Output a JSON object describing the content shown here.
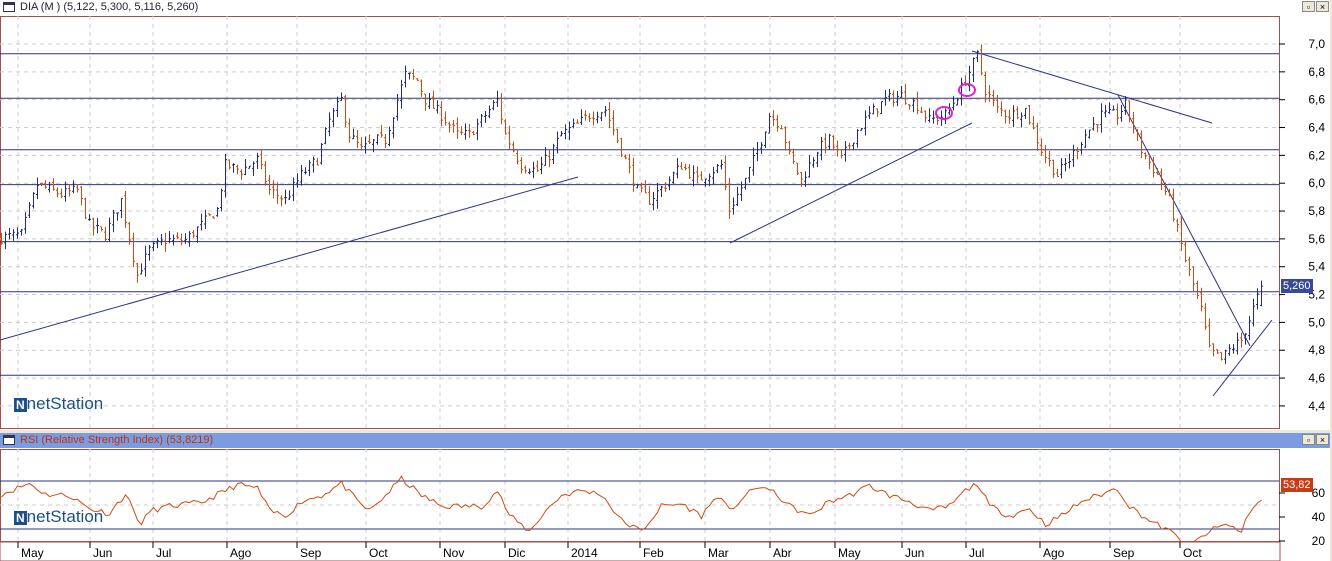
{
  "main": {
    "title": "DIA (M ) (5,122, 5,300, 5,116, 5,260)",
    "last_label": "5,260",
    "logo": "netStation",
    "y_ticks": [
      "7,0",
      "6,8",
      "6,6",
      "6,4",
      "6,2",
      "6,0",
      "5,8",
      "5,6",
      "5,4",
      "5,2",
      "5,0",
      "4,8",
      "4,6",
      "4,4"
    ]
  },
  "rsi": {
    "title": "RSI (Relative Strength Index) (53,8219)",
    "last_label": "53,82",
    "logo": "netStation",
    "y_ticks": [
      "60",
      "40",
      "20"
    ]
  },
  "window_buttons": {
    "restore": "▫",
    "close": "×"
  },
  "months": [
    "May",
    "Jun",
    "Jul",
    "Ago",
    "Sep",
    "Oct",
    "Nov",
    "Dic",
    "2014",
    "Feb",
    "Mar",
    "Abr",
    "May",
    "Jun",
    "Jul",
    "Ago",
    "Sep",
    "Oct"
  ],
  "colors": {
    "up": "#1f2a8a",
    "down": "#d04a10",
    "line": "#2b3580",
    "rsi": "#d04a10",
    "header_rsi": "#7b9de0",
    "frame": "#a05050"
  },
  "chart_data": {
    "type": "ohlc",
    "price_range": [
      4.4,
      7.0
    ],
    "support_resistance_levels": [
      6.93,
      6.61,
      6.24,
      5.99,
      5.58,
      5.22,
      4.62
    ],
    "last": {
      "open": 5.122,
      "high": 5.3,
      "low": 5.116,
      "close": 5.26
    },
    "close_keypoints": [
      [
        0,
        5.61
      ],
      [
        5,
        5.63
      ],
      [
        9,
        5.99
      ],
      [
        15,
        5.92
      ],
      [
        19,
        5.95
      ],
      [
        22,
        5.7
      ],
      [
        26,
        5.63
      ],
      [
        30,
        5.88
      ],
      [
        34,
        5.34
      ],
      [
        37,
        5.52
      ],
      [
        41,
        5.59
      ],
      [
        46,
        5.59
      ],
      [
        50,
        5.7
      ],
      [
        54,
        5.81
      ],
      [
        56,
        6.13
      ],
      [
        60,
        6.09
      ],
      [
        64,
        6.17
      ],
      [
        67,
        5.95
      ],
      [
        71,
        5.88
      ],
      [
        75,
        6.06
      ],
      [
        79,
        6.17
      ],
      [
        82,
        6.45
      ],
      [
        85,
        6.6
      ],
      [
        87,
        6.35
      ],
      [
        90,
        6.24
      ],
      [
        94,
        6.31
      ],
      [
        96,
        6.31
      ],
      [
        99,
        6.6
      ],
      [
        101,
        6.78
      ],
      [
        104,
        6.74
      ],
      [
        106,
        6.6
      ],
      [
        110,
        6.49
      ],
      [
        114,
        6.35
      ],
      [
        117,
        6.35
      ],
      [
        121,
        6.49
      ],
      [
        124,
        6.6
      ],
      [
        126,
        6.35
      ],
      [
        130,
        6.13
      ],
      [
        134,
        6.09
      ],
      [
        137,
        6.2
      ],
      [
        140,
        6.35
      ],
      [
        144,
        6.42
      ],
      [
        147,
        6.49
      ],
      [
        151,
        6.53
      ],
      [
        155,
        6.24
      ],
      [
        159,
        5.95
      ],
      [
        162,
        5.88
      ],
      [
        166,
        5.99
      ],
      [
        170,
        6.13
      ],
      [
        174,
        6.02
      ],
      [
        176,
        6.06
      ],
      [
        180,
        6.13
      ],
      [
        182,
        5.81
      ],
      [
        186,
        6.02
      ],
      [
        190,
        6.31
      ],
      [
        192,
        6.49
      ],
      [
        195,
        6.42
      ],
      [
        197,
        6.2
      ],
      [
        200,
        6.02
      ],
      [
        204,
        6.24
      ],
      [
        207,
        6.31
      ],
      [
        210,
        6.17
      ],
      [
        214,
        6.38
      ],
      [
        217,
        6.49
      ],
      [
        221,
        6.6
      ],
      [
        225,
        6.63
      ],
      [
        229,
        6.56
      ],
      [
        232,
        6.45
      ],
      [
        236,
        6.49
      ],
      [
        239,
        6.63
      ],
      [
        241,
        6.74
      ],
      [
        244,
        6.92
      ],
      [
        246,
        6.67
      ],
      [
        249,
        6.53
      ],
      [
        252,
        6.49
      ],
      [
        256,
        6.53
      ],
      [
        260,
        6.24
      ],
      [
        264,
        6.06
      ],
      [
        267,
        6.17
      ],
      [
        271,
        6.35
      ],
      [
        275,
        6.49
      ],
      [
        279,
        6.49
      ],
      [
        281,
        6.56
      ],
      [
        285,
        6.24
      ],
      [
        289,
        6.06
      ],
      [
        292,
        5.88
      ],
      [
        296,
        5.45
      ],
      [
        300,
        5.09
      ],
      [
        302,
        4.8
      ],
      [
        305,
        4.73
      ],
      [
        307,
        4.8
      ],
      [
        310,
        4.87
      ],
      [
        312,
        5.02
      ],
      [
        315,
        5.26
      ]
    ],
    "rsi_range": [
      0,
      80
    ],
    "rsi_levels": [
      70,
      30
    ],
    "rsi_keypoints": [
      [
        0,
        59
      ],
      [
        7,
        68
      ],
      [
        11,
        59
      ],
      [
        17,
        58
      ],
      [
        22,
        47
      ],
      [
        27,
        43
      ],
      [
        31,
        59
      ],
      [
        35,
        33
      ],
      [
        37,
        45
      ],
      [
        42,
        49
      ],
      [
        50,
        52
      ],
      [
        56,
        62
      ],
      [
        59,
        67
      ],
      [
        64,
        64
      ],
      [
        67,
        45
      ],
      [
        71,
        41
      ],
      [
        75,
        53
      ],
      [
        80,
        58
      ],
      [
        85,
        68
      ],
      [
        89,
        53
      ],
      [
        92,
        45
      ],
      [
        96,
        58
      ],
      [
        100,
        72
      ],
      [
        105,
        58
      ],
      [
        110,
        49
      ],
      [
        115,
        49
      ],
      [
        120,
        49
      ],
      [
        124,
        62
      ],
      [
        127,
        41
      ],
      [
        132,
        28
      ],
      [
        136,
        45
      ],
      [
        140,
        58
      ],
      [
        145,
        62
      ],
      [
        150,
        59
      ],
      [
        155,
        37
      ],
      [
        160,
        28
      ],
      [
        165,
        49
      ],
      [
        170,
        51
      ],
      [
        175,
        41
      ],
      [
        179,
        58
      ],
      [
        182,
        45
      ],
      [
        186,
        58
      ],
      [
        190,
        66
      ],
      [
        194,
        58
      ],
      [
        197,
        49
      ],
      [
        202,
        41
      ],
      [
        207,
        53
      ],
      [
        212,
        58
      ],
      [
        217,
        66
      ],
      [
        222,
        58
      ],
      [
        227,
        53
      ],
      [
        232,
        45
      ],
      [
        237,
        49
      ],
      [
        241,
        62
      ],
      [
        244,
        68
      ],
      [
        247,
        49
      ],
      [
        252,
        41
      ],
      [
        257,
        47
      ],
      [
        261,
        34
      ],
      [
        265,
        41
      ],
      [
        270,
        53
      ],
      [
        275,
        59
      ],
      [
        279,
        64
      ],
      [
        282,
        49
      ],
      [
        287,
        37
      ],
      [
        292,
        28
      ],
      [
        297,
        16
      ],
      [
        302,
        28
      ],
      [
        306,
        34
      ],
      [
        310,
        28
      ],
      [
        312,
        45
      ],
      [
        315,
        54
      ]
    ]
  }
}
